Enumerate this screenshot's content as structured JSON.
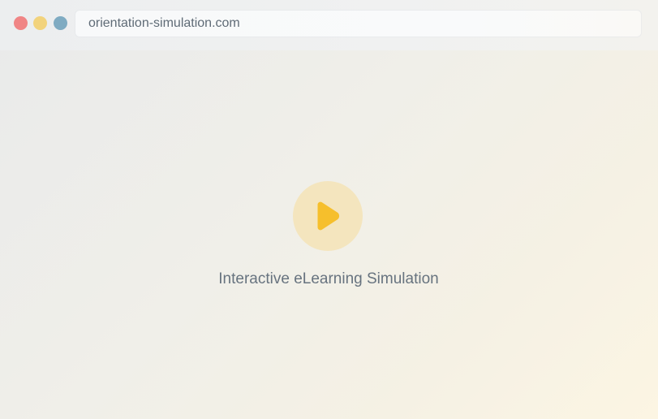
{
  "browser": {
    "url": "orientation-simulation.com",
    "window_controls": [
      {
        "name": "close",
        "color": "#f08585"
      },
      {
        "name": "minimize",
        "color": "#f2d37c"
      },
      {
        "name": "maximize",
        "color": "#7fabc2"
      }
    ]
  },
  "main": {
    "play_icon": "play-icon",
    "play_circle_color": "#f4e5be",
    "play_triangle_color": "#f6bf2c",
    "caption": "Interactive eLearning Simulation"
  }
}
